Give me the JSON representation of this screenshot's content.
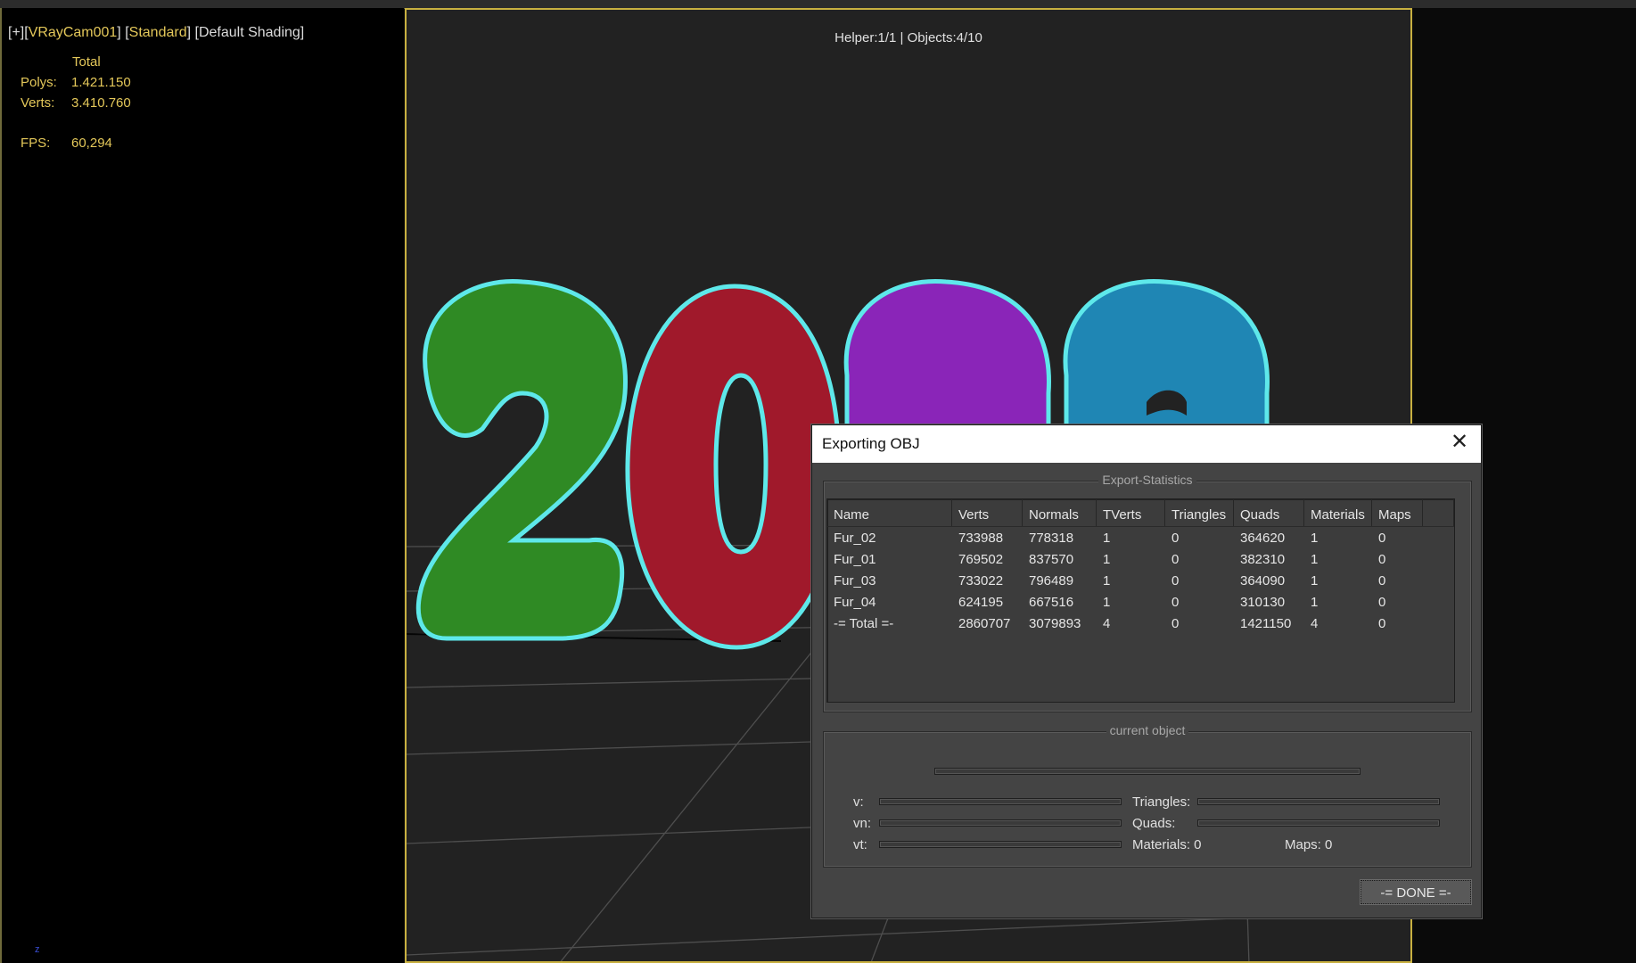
{
  "viewport_left": {
    "label_parts": [
      "[+]",
      "[",
      "VRayCam001",
      "]",
      "[",
      "Standard",
      "]",
      "[Default Shading]"
    ],
    "stats_header": "Total",
    "polys_label": "Polys:",
    "polys_value": "1.421.150",
    "verts_label": "Verts:",
    "verts_value": "3.410.760",
    "fps_label": "FPS:",
    "fps_value": "60,294",
    "axis_mini": "z"
  },
  "viewport_main": {
    "info": "Helper:1/1 | Objects:4/10",
    "scene_colors": {
      "digit1": "#2f8a24",
      "digit2": "#a0192b",
      "digit3": "#8a25b8",
      "digit4": "#1f86b4",
      "outline": "#5ee8ea",
      "grid": "#4a4a4a"
    }
  },
  "dialog": {
    "title": "Exporting OBJ",
    "close_glyph": "✕",
    "export_group_title": "Export-Statistics",
    "columns": [
      "Name",
      "Verts",
      "Normals",
      "TVerts",
      "Triangles",
      "Quads",
      "Materials",
      "Maps"
    ],
    "rows": [
      [
        "Fur_02",
        "733988",
        "778318",
        "1",
        "0",
        "364620",
        "1",
        "0"
      ],
      [
        "Fur_01",
        "769502",
        "837570",
        "1",
        "0",
        "382310",
        "1",
        "0"
      ],
      [
        "Fur_03",
        "733022",
        "796489",
        "1",
        "0",
        "364090",
        "1",
        "0"
      ],
      [
        "Fur_04",
        "624195",
        "667516",
        "1",
        "0",
        "310130",
        "1",
        "0"
      ],
      [
        "-= Total =-",
        "2860707",
        "3079893",
        "4",
        "0",
        "1421150",
        "4",
        "0"
      ]
    ],
    "current_group_title": "current object",
    "v_label": "v:",
    "vn_label": "vn:",
    "vt_label": "vt:",
    "triangles_label": "Triangles:",
    "quads_label": "Quads:",
    "materials_text": "Materials: 0",
    "maps_text": "Maps:  0",
    "done_label": "-= DONE =-"
  }
}
